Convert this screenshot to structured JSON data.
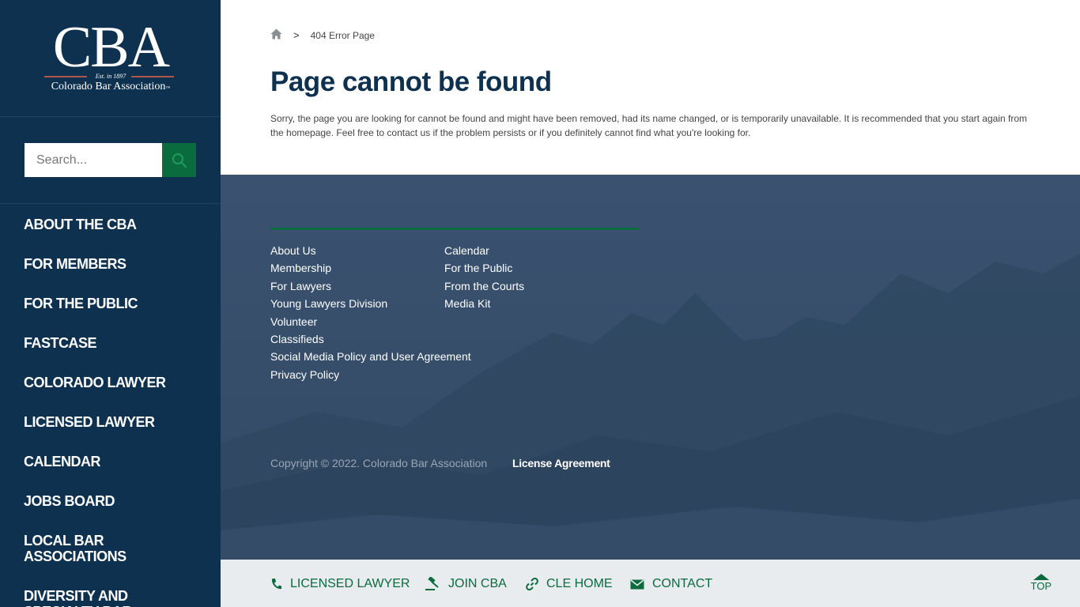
{
  "logo": {
    "mark": "CBA",
    "est": "Est. in 1897",
    "name": "Colorado Bar Association",
    "tm": "™"
  },
  "search": {
    "placeholder": "Search..."
  },
  "nav": {
    "items": [
      "ABOUT THE CBA",
      "FOR MEMBERS",
      "FOR THE PUBLIC",
      "FASTCASE",
      "COLORADO LAWYER",
      "LICENSED LAWYER",
      "CALENDAR",
      "JOBS BOARD",
      "LOCAL BAR ASSOCIATIONS",
      "DIVERSITY AND SPECIALTY BAR"
    ]
  },
  "breadcrumb": {
    "separator": ">",
    "current": "404 Error Page"
  },
  "main": {
    "title": "Page cannot be found",
    "body": "Sorry, the page you are looking for cannot be found and might have been removed, had its name changed, or is temporarily unavailable. It is recommended that you start again from the homepage. Feel free to contact us if the problem persists or if you definitely cannot find what you're looking for."
  },
  "footer": {
    "col1": [
      "About Us",
      "Membership",
      "For Lawyers",
      "Young Lawyers Division",
      "Volunteer",
      "Classifieds",
      "Social Media Policy and User Agreement",
      "Privacy Policy"
    ],
    "col2": [
      "Calendar",
      "For the Public",
      "From the Courts",
      "Media Kit"
    ],
    "copyright": "Copyright © 2022. Colorado Bar Association",
    "license": "License Agreement"
  },
  "bottombar": {
    "licensed": "LICENSED LAWYER",
    "join": "JOIN CBA",
    "cle": "CLE HOME",
    "contact": "CONTACT",
    "top": "TOP"
  },
  "colors": {
    "navy": "#0e3150",
    "green": "#0a6b3e",
    "footer": "#354c66"
  }
}
